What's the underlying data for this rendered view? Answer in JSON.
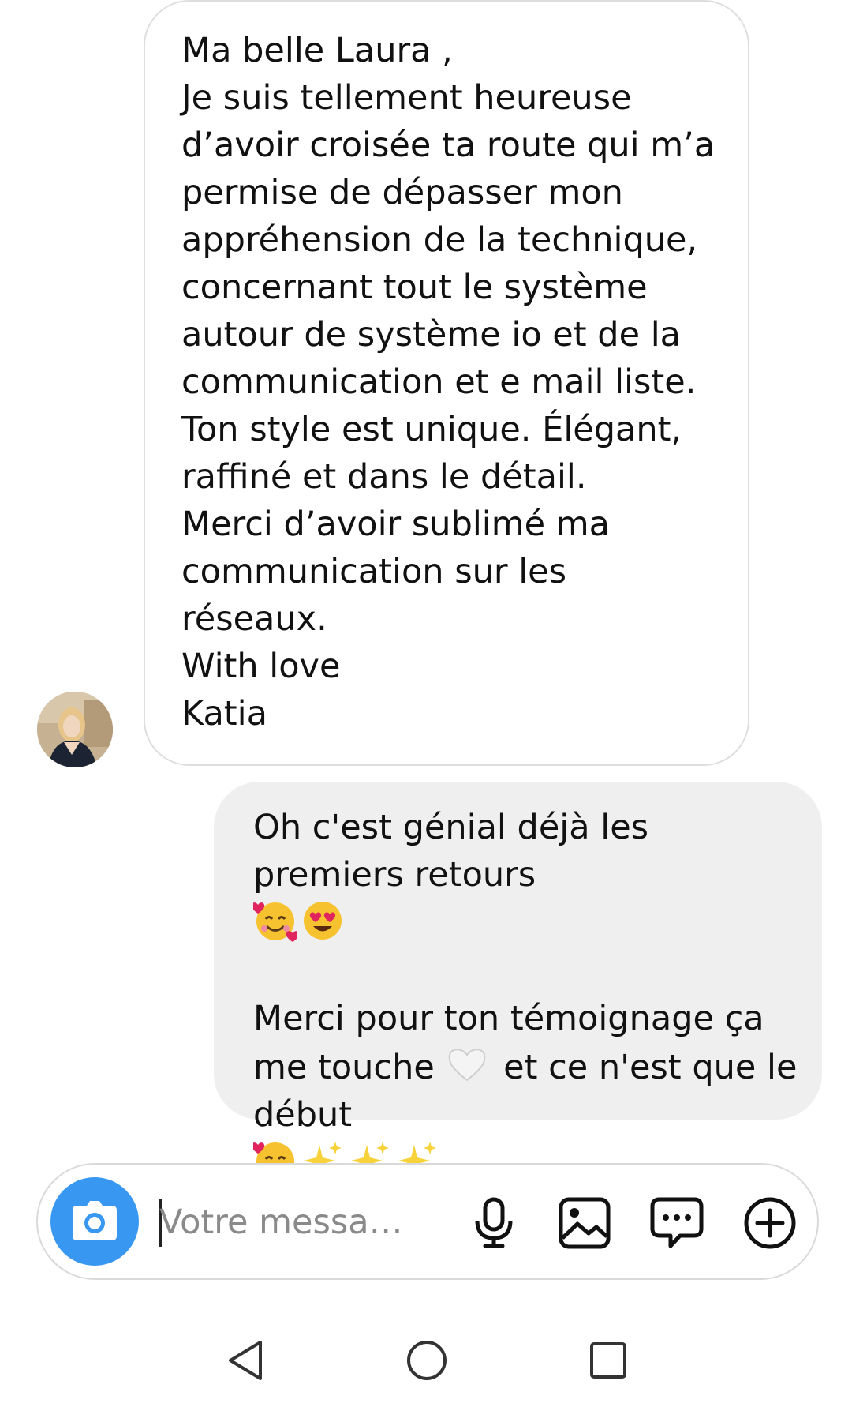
{
  "incoming_message": {
    "text": "Ma belle Laura ,\nJe suis tellement heureuse d’avoir croisée ta route qui m’a permise de dépasser mon appréhension de la technique, concernant tout le système autour de système io et de la communication et e mail liste.\nTon style est unique. Élégant, raffiné et dans le détail.\nMerci d’avoir sublimé ma communication sur les réseaux.\nWith love\nKatia"
  },
  "outgoing_message": {
    "line1": "Oh c'est génial déjà les premiers retours",
    "line2": "Merci pour ton témoignage ça me touche",
    "line3": "et ce n'est que le début"
  },
  "composer": {
    "placeholder": "Votre messa…"
  },
  "icons": {
    "camera": "camera-icon",
    "microphone": "microphone-icon",
    "gallery": "image-icon",
    "sticker": "chat-bubble-icon",
    "add": "plus-circle-icon",
    "back": "back-triangle-icon",
    "home": "home-circle-icon",
    "recents": "recents-square-icon"
  },
  "colors": {
    "accent": "#3897f0",
    "outgoing_bubble": "#efefef",
    "incoming_border": "#dedede"
  }
}
